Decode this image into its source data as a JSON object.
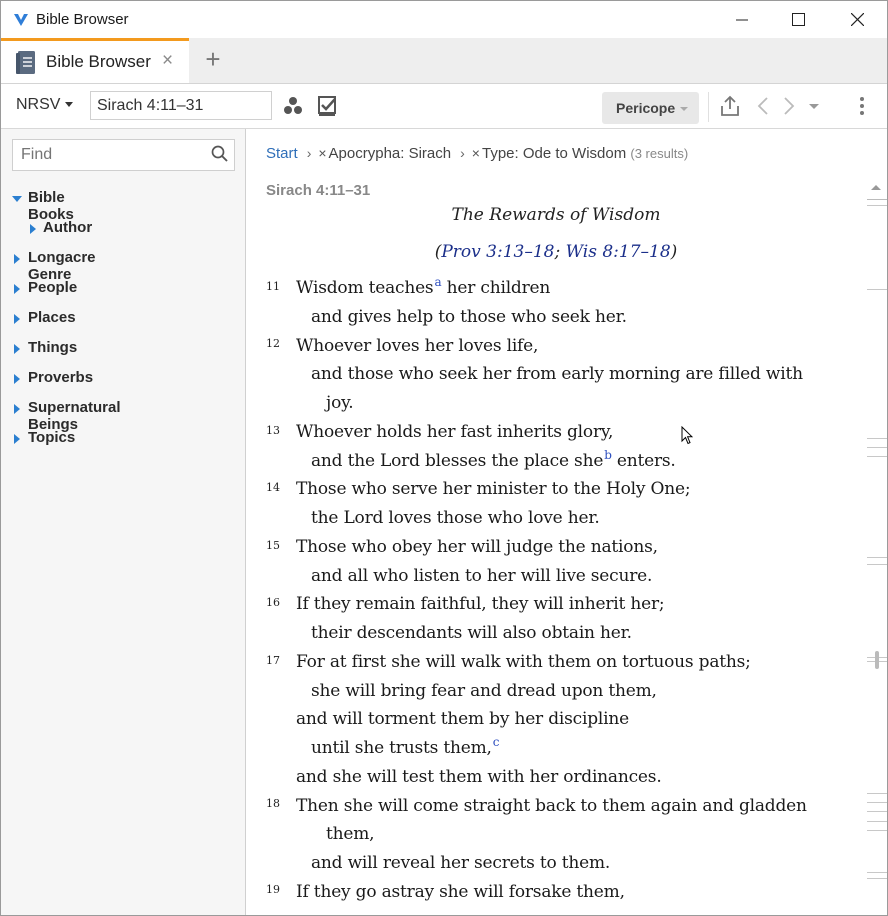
{
  "window": {
    "title": "Bible Browser"
  },
  "tab": {
    "label": "Bible Browser",
    "close": "×",
    "new_tab": "+"
  },
  "toolbar": {
    "version": "NRSV",
    "reference": "Sirach 4:11–31",
    "pericope_label": "Pericope"
  },
  "sidebar": {
    "find_placeholder": "Find",
    "items": [
      {
        "label": "Bible Books",
        "expanded": true,
        "level": 0
      },
      {
        "label": "Author",
        "expanded": false,
        "level": 1
      },
      {
        "label": "Longacre Genre",
        "expanded": false,
        "level": 0
      },
      {
        "label": "People",
        "expanded": false,
        "level": 0
      },
      {
        "label": "Places",
        "expanded": false,
        "level": 0
      },
      {
        "label": "Things",
        "expanded": false,
        "level": 0
      },
      {
        "label": "Proverbs",
        "expanded": false,
        "level": 0
      },
      {
        "label": "Supernatural Beings",
        "expanded": false,
        "level": 0
      },
      {
        "label": "Topics",
        "expanded": false,
        "level": 0
      }
    ]
  },
  "breadcrumb": {
    "start": "Start",
    "filter1": "Apocrypha: Sirach",
    "filter2": "Type: Ode to Wisdom",
    "results": "(3 results)",
    "remove": "×",
    "sep": "›"
  },
  "passage": {
    "ref_label": "Sirach 4:11–31",
    "heading": "The Rewards of Wisdom",
    "crossref_open": "(",
    "crossref_1": "Prov 3:13–18",
    "crossref_sep": "; ",
    "crossref_2": "Wis 8:17–18",
    "crossref_close": ")",
    "verse_numbers": [
      "11",
      "12",
      "13",
      "14",
      "15",
      "16",
      "17",
      "18",
      "19"
    ],
    "lines": [
      "Wisdom teaches",
      "a",
      " her children",
      "and gives help to those who seek her.",
      "Whoever loves her loves life,",
      "and those who seek her from early morning are filled with",
      "joy.",
      "Whoever holds her fast inherits glory,",
      "and the Lord blesses the place she",
      "b",
      " enters.",
      "Those who serve her minister to the Holy One;",
      "the Lord loves those who love her.",
      "Those who obey her will judge the nations,",
      "and all who listen to her will live secure.",
      "If they remain faithful, they will inherit her;",
      "their descendants will also obtain her.",
      "For at first she will walk with them on tortuous paths;",
      "she will bring fear and dread upon them,",
      "and will torment them by her discipline",
      "until she trusts them,",
      "c",
      "and she will test them with her ordinances.",
      "Then she will come straight back to them again and gladden",
      "them,",
      "and will reveal her secrets to them.",
      "If they go astray she will forsake them,"
    ]
  }
}
